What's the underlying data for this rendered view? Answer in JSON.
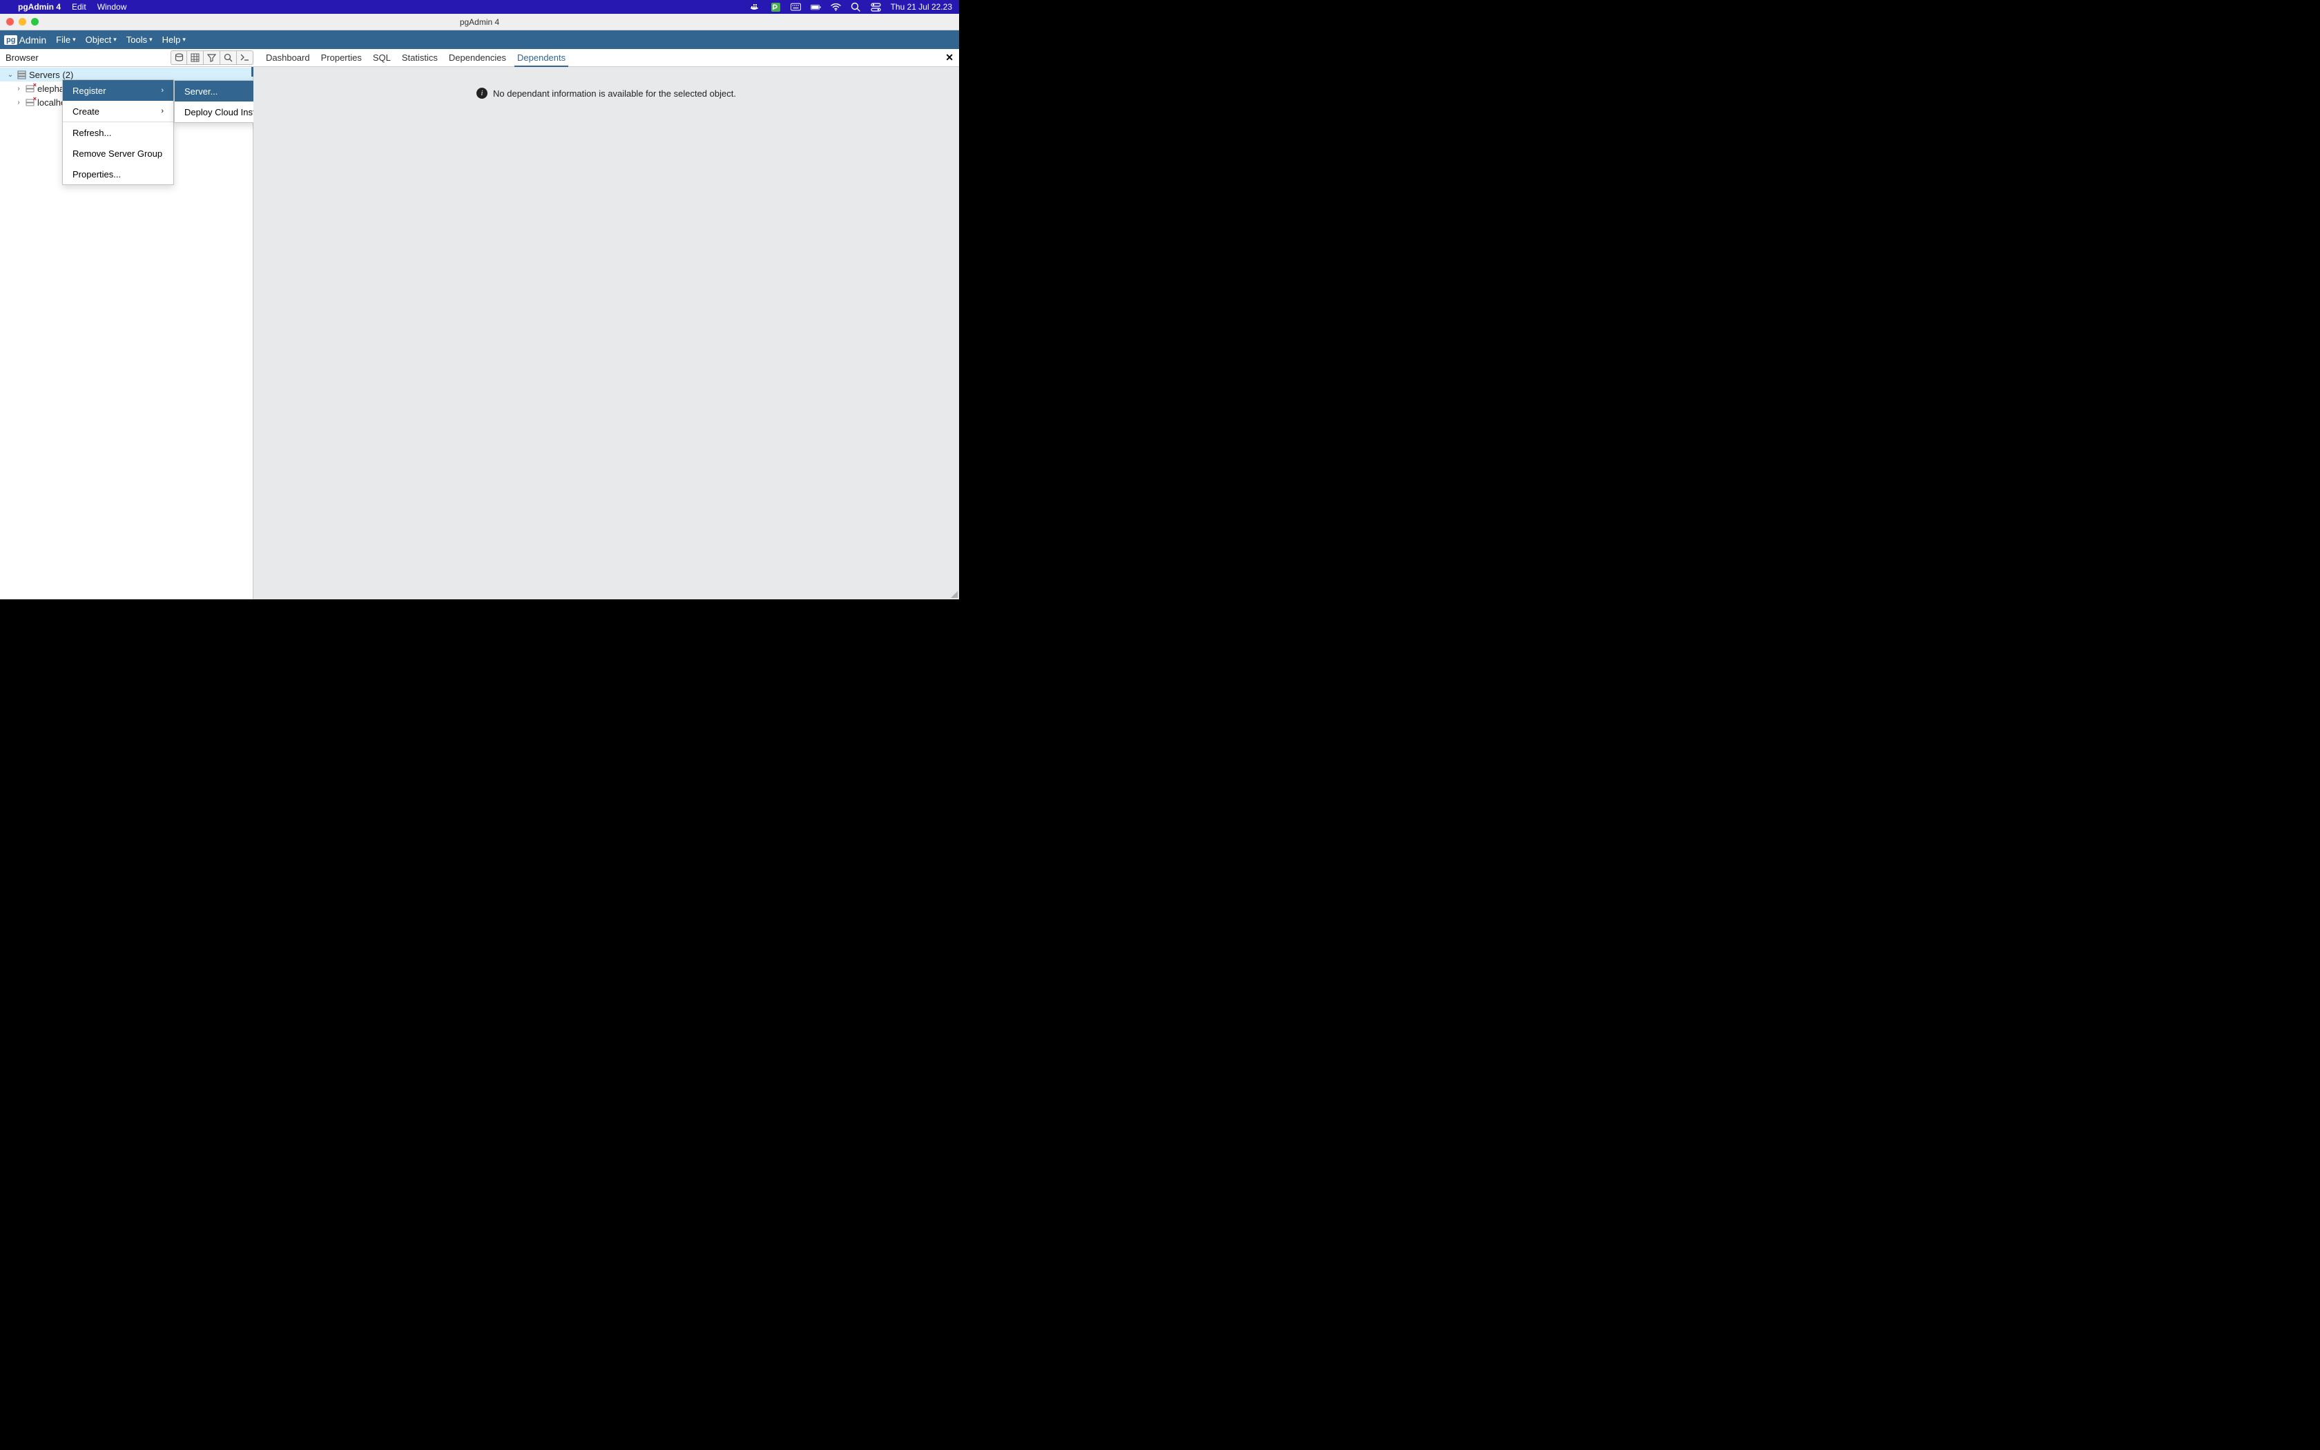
{
  "macos": {
    "appname": "pgAdmin 4",
    "menu": [
      "Edit",
      "Window"
    ],
    "clock": "Thu 21 Jul  22.23"
  },
  "window": {
    "title": "pgAdmin 4"
  },
  "pgmenu": {
    "file": "File",
    "object": "Object",
    "tools": "Tools",
    "help": "Help"
  },
  "browser": {
    "label": "Browser"
  },
  "tabs": {
    "dashboard": "Dashboard",
    "properties": "Properties",
    "sql": "SQL",
    "statistics": "Statistics",
    "dependencies": "Dependencies",
    "dependents": "Dependents"
  },
  "tree": {
    "servers_label": "Servers (2)",
    "server1": "elephant",
    "server2": "localhost"
  },
  "context_menu": {
    "register": "Register",
    "create": "Create",
    "refresh": "Refresh...",
    "remove_group": "Remove Server Group",
    "properties": "Properties..."
  },
  "submenu": {
    "server": "Server...",
    "deploy_cloud": "Deploy Cloud Instance..."
  },
  "main": {
    "empty_message": "No dependant information is available for the selected object."
  }
}
